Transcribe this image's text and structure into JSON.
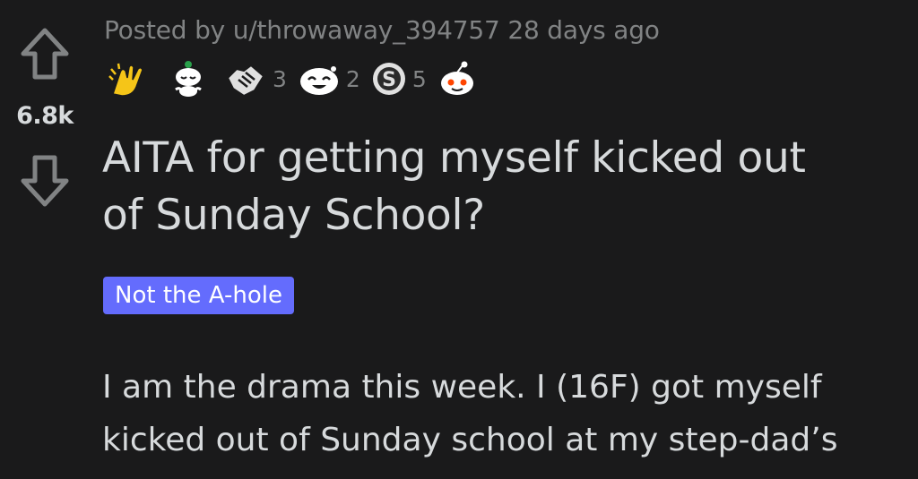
{
  "vote": {
    "score": "6.8k"
  },
  "post": {
    "meta_line": "Posted by u/throwaway_394757 28 days ago",
    "awards": [
      {
        "icon": "clapping-hands-award-icon",
        "count": ""
      },
      {
        "icon": "snoo-meditate-award-icon",
        "count": ""
      },
      {
        "icon": "handshake-award-icon",
        "count": "3"
      },
      {
        "icon": "snoo-laughing-award-icon",
        "count": "2"
      },
      {
        "icon": "silver-coin-award-icon",
        "count": "5"
      },
      {
        "icon": "snoo-wholesome-award-icon",
        "count": ""
      }
    ],
    "title_line1": "AITA for getting myself kicked out",
    "title_line2": "of Sunday School?",
    "flair": "Not the A-hole",
    "body_line1": "I am the drama this week. I (16F) got myself",
    "body_line2": "kicked out of Sunday school at my step-dad’s"
  },
  "colors": {
    "background": "#1a1a1b",
    "text_primary": "#d7dadc",
    "text_meta": "#818384",
    "flair_bg": "#646cfd",
    "flair_text": "#ffffff"
  }
}
